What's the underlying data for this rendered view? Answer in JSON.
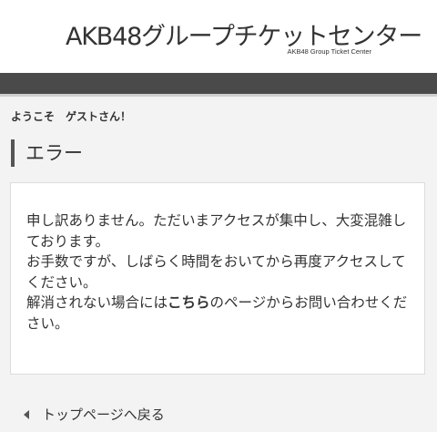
{
  "header": {
    "logo_main": "AKB48グループチケットセンター",
    "logo_sub": "AKB48 Group Ticket Center"
  },
  "welcome": "ようこそ　ゲストさん！",
  "section_title": "エラー",
  "error": {
    "line1": "申し訳ありません。ただいまアクセスが集中し、大変混雑しております。",
    "line2": "お手数ですが、しばらく時間をおいてから再度アクセスしてください。",
    "line3_pre": "解消されない場合には",
    "line3_link": "こちら",
    "line3_post": "のページからお問い合わせください。"
  },
  "back_link": "トップページへ戻る",
  "colors": {
    "background": "#f3f3f3",
    "nav_bar": "#4a4a4a",
    "text": "#333333"
  }
}
